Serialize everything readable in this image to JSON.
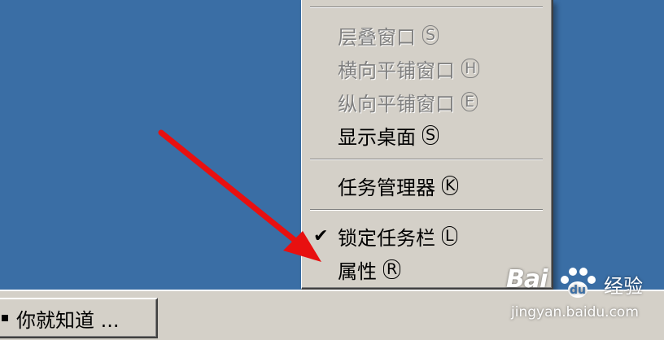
{
  "menu": {
    "items": [
      {
        "label": "层叠窗口",
        "accel": "S",
        "state": "disabled",
        "checked": false
      },
      {
        "label": "横向平铺窗口",
        "accel": "H",
        "state": "disabled",
        "checked": false
      },
      {
        "label": "纵向平铺窗口",
        "accel": "E",
        "state": "disabled",
        "checked": false
      },
      {
        "label": "显示桌面",
        "accel": "S",
        "state": "enabled",
        "checked": false
      },
      {
        "label": "任务管理器",
        "accel": "K",
        "state": "enabled",
        "checked": false
      },
      {
        "label": "锁定任务栏",
        "accel": "L",
        "state": "enabled",
        "checked": true
      },
      {
        "label": "属性",
        "accel": "R",
        "state": "enabled",
        "checked": false
      }
    ]
  },
  "taskbar": {
    "button_label": "你就知道 ..."
  },
  "watermark": {
    "logo": "Bai",
    "logo_tail": "du",
    "cn": "经验",
    "url": "jingyan.baidu.com"
  },
  "colors": {
    "desktop": "#3a6ea5",
    "menu_bg": "#d4d0c8",
    "disabled_text": "#808080",
    "arrow": "#e81010"
  },
  "icons": {
    "check": "checkmark-icon",
    "arrow": "red-arrow-annotation",
    "paw": "baidu-paw-icon"
  }
}
